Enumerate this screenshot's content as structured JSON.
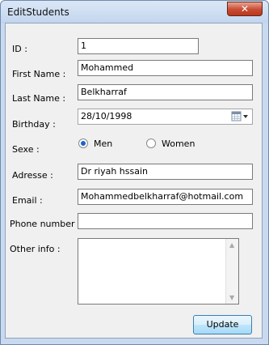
{
  "window": {
    "title": "EditStudents",
    "close_glyph": "✕"
  },
  "form": {
    "id_label": "ID :",
    "id_value": "1",
    "first_name_label": "First Name :",
    "first_name_value": "Mohammed",
    "last_name_label": "Last Name :",
    "last_name_value": "Belkharraf",
    "birthday_label": "Birthday :",
    "birthday_value": "28/10/1998",
    "sexe_label": "Sexe :",
    "sexe_options": [
      {
        "label": "Men",
        "selected": true
      },
      {
        "label": "Women",
        "selected": false
      }
    ],
    "adresse_label": "Adresse :",
    "adresse_value": "Dr riyah hssain",
    "email_label": "Email :",
    "email_value": "Mohammedbelkharraf@hotmail.com",
    "phone_label": "Phone number :",
    "phone_value": "",
    "other_info_label": "Other info :",
    "other_info_value": "",
    "update_label": "Update"
  },
  "icons": {
    "calendar": "calendar-icon",
    "dropdown": "chevron-down-icon",
    "scroll_up": "▲",
    "scroll_down": "▼"
  },
  "colors": {
    "radio_selected": "#1c64c8",
    "titlebar": "#c9daf0",
    "close": "#c74b32"
  }
}
